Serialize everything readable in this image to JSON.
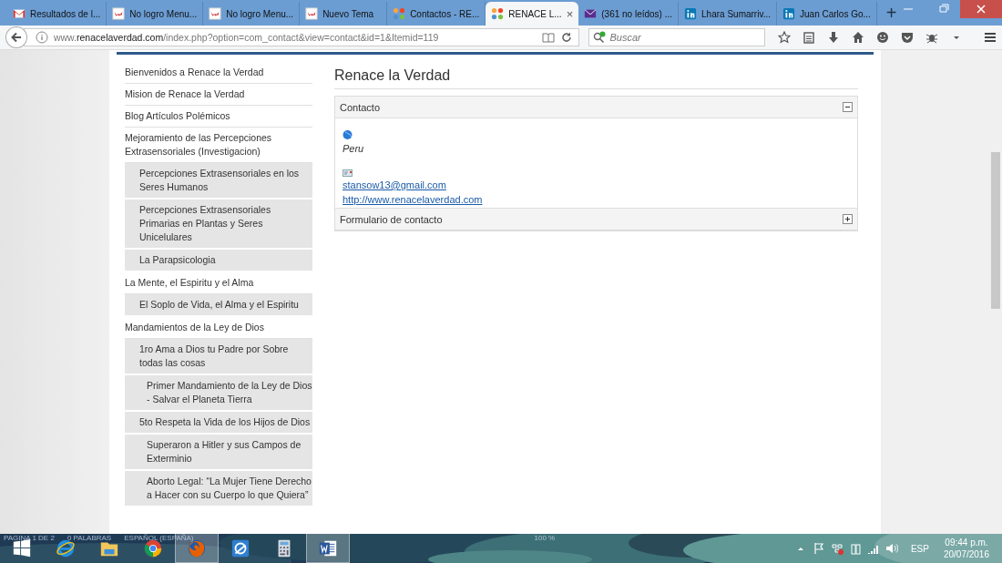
{
  "tabs": [
    {
      "kind": "gmail",
      "label": "Resultados de l...",
      "selected": false
    },
    {
      "kind": "w",
      "label": "No logro Menu...",
      "selected": false
    },
    {
      "kind": "w",
      "label": "No logro Menu...",
      "selected": false
    },
    {
      "kind": "w",
      "label": "Nuevo Tema",
      "selected": false
    },
    {
      "kind": "joomla",
      "label": "Contactos - RE...",
      "selected": false
    },
    {
      "kind": "joomla",
      "label": "RENACE L...",
      "selected": true,
      "close": "×"
    },
    {
      "kind": "mail",
      "label": "(361 no leídos) ...",
      "selected": false
    },
    {
      "kind": "in",
      "label": "Lhara Sumarriv...",
      "selected": false
    },
    {
      "kind": "in",
      "label": "Juan Carlos Go...",
      "selected": false
    }
  ],
  "new_tab": "+",
  "url": {
    "prefix": "www.",
    "domain": "renacelaverdad.com",
    "path": "/index.php?option=com_contact&view=contact&id=1&Itemid=119"
  },
  "search": {
    "placeholder": "Buscar"
  },
  "sidebar": {
    "items": [
      {
        "label": "Bienvenidos a Renace la Verdad"
      },
      {
        "label": "Mision de Renace la Verdad"
      },
      {
        "label": "Blog Artículos Polémicos"
      },
      {
        "label": "Mejoramiento de las Percepciones Extrasensoriales (Investigacion)",
        "children": [
          {
            "label": "Percepciones Extrasensoriales en los Seres Humanos"
          },
          {
            "label": "Percepciones Extrasensoriales Primarias en Plantas y Seres Unicelulares"
          },
          {
            "label": "La Parapsicologia"
          }
        ]
      },
      {
        "label": "La Mente, el Espiritu y el Alma",
        "children": [
          {
            "label": "El Soplo de Vida, el Alma y el Espiritu"
          }
        ]
      },
      {
        "label": "Mandamientos de la Ley de Dios",
        "children": [
          {
            "label": "1ro Ama a Dios tu Padre por Sobre todas las cosas",
            "children": [
              {
                "label": "Primer Mandamiento de la Ley de Dios - Salvar el Planeta Tierra"
              }
            ]
          },
          {
            "label": "5to Respeta la Vida de los Hijos de Dios",
            "children": [
              {
                "label": "Superaron a Hitler y sus Campos de Exterminio"
              },
              {
                "label": "Aborto Legal: “La Mujer Tiene Derecho a Hacer con su Cuerpo lo que Quiera”"
              }
            ]
          }
        ]
      }
    ]
  },
  "page_title": "Renace la Verdad",
  "panels": [
    {
      "title": "Contacto",
      "expanded": true,
      "country": "Peru",
      "email": "stansow13@gmail.com",
      "website": "http://www.renacelaverdad.com"
    },
    {
      "title": "Formulario de contacto",
      "expanded": false
    }
  ],
  "word_status": [
    "PAGINA 1 DE 2",
    "0 PALABRAS",
    "ESPAÑOL (ESPAÑA)",
    "100 %"
  ],
  "taskbar": {
    "apps": [
      {
        "kind": "windows",
        "active": false
      },
      {
        "kind": "ie",
        "active": false
      },
      {
        "kind": "folder",
        "active": false
      },
      {
        "kind": "chrome",
        "active": false
      },
      {
        "kind": "firefox",
        "active": true
      },
      {
        "kind": "app",
        "active": false
      },
      {
        "kind": "calculator",
        "active": false
      },
      {
        "kind": "word",
        "active": true
      }
    ],
    "language": "ESP",
    "time": "09:44 p.m.",
    "date": "20/07/2016"
  }
}
